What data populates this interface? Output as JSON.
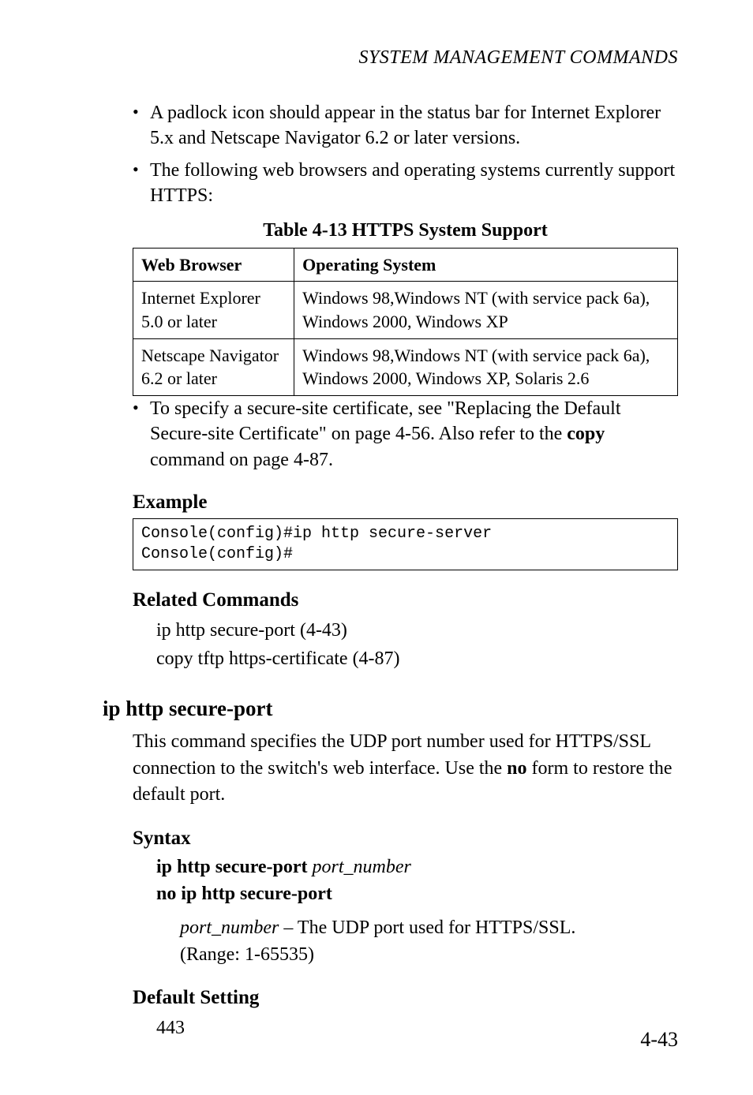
{
  "running_head": "SYSTEM MANAGEMENT COMMANDS",
  "bullets": [
    "A padlock icon should appear in the status bar for Internet Explorer 5.x and Netscape Navigator 6.2 or later versions.",
    "The following web browsers and operating systems currently support HTTPS:"
  ],
  "table": {
    "caption": "Table 4-13  HTTPS System Support",
    "headers": [
      "Web Browser",
      "Operating System"
    ],
    "rows": [
      [
        "Internet Explorer 5.0 or later",
        "Windows 98,Windows NT (with service pack 6a), Windows 2000, Windows XP"
      ],
      [
        "Netscape Navigator 6.2 or later",
        "Windows 98,Windows NT (with service pack 6a), Windows 2000, Windows XP, Solaris 2.6"
      ]
    ]
  },
  "after_table_bullet_parts": {
    "p1": "To specify a secure-site certificate, see \"Replacing the Default Secure-site Certificate\" on page 4-56. Also refer to the ",
    "bold": "copy",
    "p2": " command on page 4-87."
  },
  "example": {
    "label": "Example",
    "code": "Console(config)#ip http secure-server\nConsole(config)#"
  },
  "related": {
    "label": "Related Commands",
    "lines": [
      "ip http secure-port (4-43)",
      "copy tftp https-certificate (4-87)"
    ]
  },
  "cmd": {
    "heading": "ip http secure-port",
    "desc_parts": {
      "p1": "This command specifies the UDP port number used for HTTPS/SSL connection to the switch's web interface. Use the ",
      "bold": "no",
      "p2": " form to restore the default port."
    },
    "syntax_label": "Syntax",
    "syntax_line1": {
      "bold": "ip http secure-port ",
      "italic": "port_number"
    },
    "syntax_line2": "no ip http secure-port",
    "syntax_sub": {
      "italic": "port_number",
      "rest": " – The UDP port used for HTTPS/SSL.",
      "range": "(Range: 1-65535)"
    },
    "default_label": "Default Setting",
    "default_value": "443"
  },
  "page_number": "4-43"
}
